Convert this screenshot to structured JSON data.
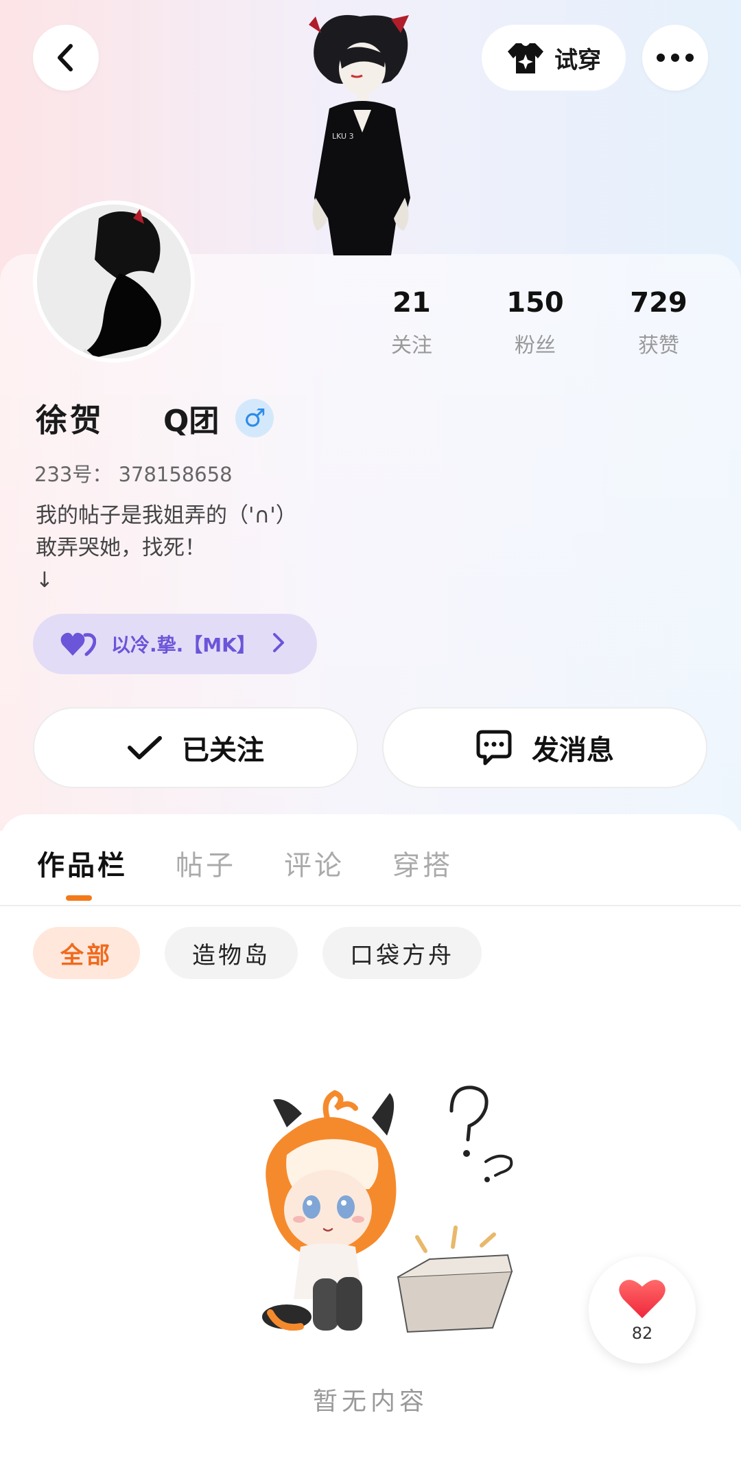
{
  "header": {
    "back_icon": "chevron-left-icon",
    "try_on_label": "试穿",
    "try_on_icon": "shirt-sparkle-icon",
    "more_icon": "more-dots-icon"
  },
  "profile": {
    "name": "徐贺",
    "team": "Q团",
    "gender_icon": "male-icon",
    "uid_label": "233号：",
    "uid": "378158658",
    "bio_lines": [
      "我的帖子是我姐弄的（'∩'）",
      "敢弄哭她，找死！",
      "↓"
    ],
    "fan_badge": {
      "icon": "double-heart-icon",
      "label": "以冷.挚.【MK】",
      "color": "#6b55d8"
    }
  },
  "stats": [
    {
      "value": "21",
      "label": "关注"
    },
    {
      "value": "150",
      "label": "粉丝"
    },
    {
      "value": "729",
      "label": "获赞"
    }
  ],
  "actions": {
    "follow_label": "已关注",
    "follow_icon": "check-icon",
    "message_label": "发消息",
    "message_icon": "chat-bubble-icon"
  },
  "tabs": [
    {
      "label": "作品栏",
      "active": true
    },
    {
      "label": "帖子",
      "active": false
    },
    {
      "label": "评论",
      "active": false
    },
    {
      "label": "穿搭",
      "active": false
    }
  ],
  "filters": [
    {
      "label": "全部",
      "active": true
    },
    {
      "label": "造物岛",
      "active": false
    },
    {
      "label": "口袋方舟",
      "active": false
    }
  ],
  "empty_state": {
    "text": "暂无内容",
    "illustration": "confused-character-empty-box"
  },
  "floating_like": {
    "icon": "heart-icon",
    "count": "82"
  },
  "colors": {
    "accent": "#f27a1a",
    "badge_bg": "#e3dcf7",
    "male_blue": "#2d8be8",
    "heart_red": "#f03a47"
  }
}
